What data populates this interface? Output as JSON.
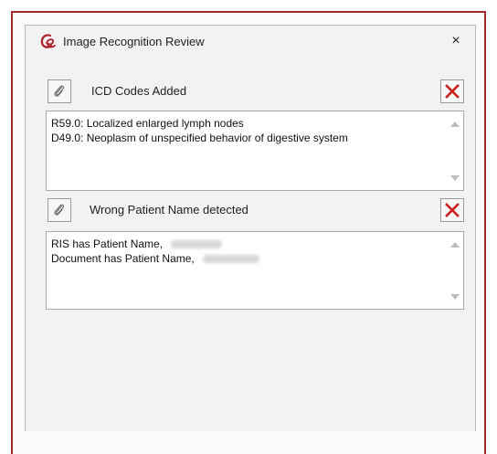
{
  "dialog": {
    "title": "Image Recognition Review",
    "close_label": "×"
  },
  "sections": [
    {
      "label": "ICD Codes Added",
      "lines": [
        "R59.0: Localized enlarged lymph nodes",
        "D49.0: Neoplasm of unspecified behavior of digestive system"
      ]
    },
    {
      "label": "Wrong Patient Name detected",
      "lines": [
        "RIS has Patient Name,",
        "Document has Patient Name,"
      ]
    }
  ],
  "colors": {
    "frame_border": "#9c2a2a",
    "delete_icon": "#cc1f1f",
    "app_icon": "#b01e2a"
  },
  "icons": {
    "app": "logo-icon",
    "attach": "paperclip-icon",
    "delete": "red-x-icon",
    "close": "close-icon"
  }
}
